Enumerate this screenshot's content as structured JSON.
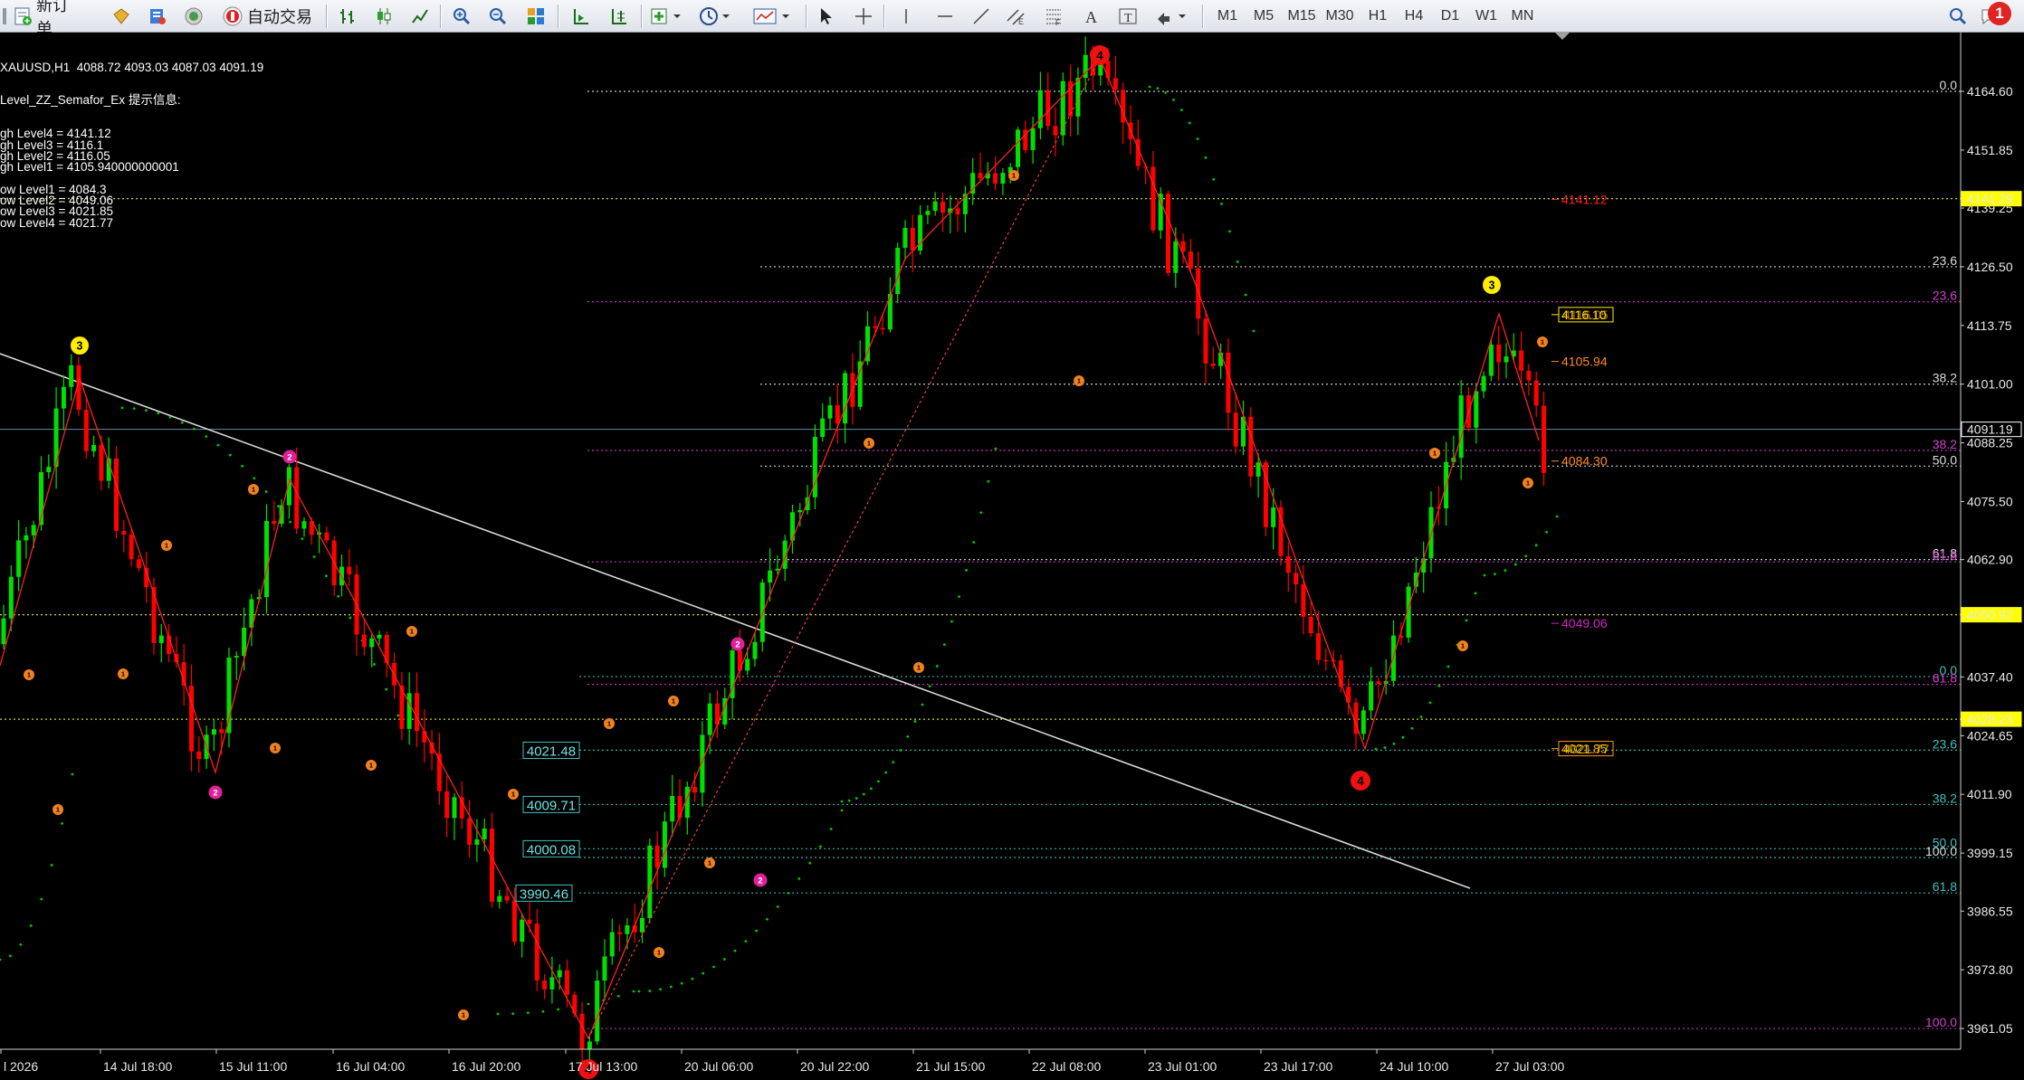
{
  "toolbar": {
    "new_order": "新订单",
    "auto_trading": "自动交易",
    "timeframes": [
      "M1",
      "M5",
      "M15",
      "M30",
      "H1",
      "H4",
      "D1",
      "W1",
      "MN"
    ],
    "notification_count": "1",
    "icons": [
      "new-order-icon",
      "strategy-tester-icon",
      "market-watch-icon",
      "signals-icon",
      "auto-trading-icon",
      "bar-chart-icon",
      "candlestick-icon",
      "line-chart-icon",
      "zoom-in-icon",
      "zoom-out-icon",
      "tile-windows-icon",
      "auto-scroll-icon",
      "chart-shift-icon",
      "indicators-icon",
      "periods-icon",
      "templates-icon",
      "cursor-icon",
      "crosshair-icon",
      "vertical-line-icon",
      "horizontal-line-icon",
      "trendline-icon",
      "equidistant-channel-icon",
      "fibonacci-icon",
      "text-icon",
      "text-label-icon",
      "arrows-icon",
      "search-icon",
      "chat-icon"
    ]
  },
  "info": {
    "symbol_line": "XAUUSD,H1  4088.72 4093.03 4087.03 4091.19",
    "indicator": "Level_ZZ_Semafor_Ex 提示信息:",
    "levels": [
      "gh Level4 = 4141.12",
      "gh Level3 = 4116.1",
      "gh Level2 = 4116.05",
      "gh Level1 = 4105.940000000001",
      "",
      "ow Level1 = 4084.3",
      "ow Level2 = 4049.06",
      "ow Level3 = 4021.85",
      "ow Level4 = 4021.77"
    ]
  },
  "price_axis": {
    "ticks": [
      "4164.60",
      "4151.85",
      "4139.25",
      "4126.50",
      "4113.75",
      "4101.00",
      "4088.25",
      "4075.50",
      "4062.90",
      "4037.40",
      "4024.65",
      "4011.90",
      "3999.15",
      "3986.55",
      "3973.80",
      "3961.05"
    ],
    "highlights": [
      {
        "label": "4141.29",
        "bg": "#ffff00",
        "fg": "#000000"
      },
      {
        "label": "4091.19",
        "bg": "#000000",
        "fg": "#ffffff"
      },
      {
        "label": "4050.92",
        "bg": "#ffff00",
        "fg": "#000000"
      },
      {
        "label": "4028.23",
        "bg": "#ffff00",
        "fg": "#000000"
      }
    ]
  },
  "time_axis": [
    "l 2026",
    "14 Jul 18:00",
    "15 Jul 11:00",
    "16 Jul 04:00",
    "16 Jul 20:00",
    "17 Jul 13:00",
    "20 Jul 06:00",
    "20 Jul 22:00",
    "21 Jul 15:00",
    "22 Jul 08:00",
    "23 Jul 01:00",
    "23 Jul 17:00",
    "24 Jul 10:00",
    "27 Jul 03:00"
  ],
  "levels_right": [
    {
      "text": "4141.12",
      "color": "#ff2020"
    },
    {
      "text": "4116.10",
      "color": "#ffee00"
    },
    {
      "text": "4116.05",
      "color": "#ff9900"
    },
    {
      "text": "4105.94",
      "color": "#ff8a20"
    },
    {
      "text": "4084.30",
      "color": "#ff8a20"
    },
    {
      "text": "4049.06",
      "color": "#d028c8"
    },
    {
      "text": "4021.85",
      "color": "#ff9900"
    },
    {
      "text": "4021.77",
      "color": "#ffee00"
    }
  ],
  "fib_boxes": [
    "4021.48",
    "4009.71",
    "4000.08",
    "3990.46"
  ],
  "fib_labels": {
    "white_top": "0.0",
    "white_236": "23.6",
    "white_382": "38.2",
    "white_50": "50.0",
    "white_618": "61.8",
    "mag_236": "23.6",
    "mag_382": "38.2",
    "mag_618": "61.8",
    "mag_100": "100.0",
    "cyan_0": "0.0",
    "cyan_236": "23.6",
    "cyan_382": "38.2",
    "cyan_50": "50.0",
    "cyan_618": "61.8",
    "cyan_100": "100.0"
  },
  "semafor": {
    "n4": "4",
    "n3": "3",
    "n2": "2",
    "n1": "1"
  },
  "colors": {
    "bull": "#00e000",
    "bear": "#ff0000",
    "zigzag": "#ff2020",
    "psar": "#00c800",
    "trend": "#d8d8d8",
    "grid_white": "#c8c8c8",
    "grid_mag": "#c030c0",
    "grid_cyan": "#30b0b0",
    "grid_yellow": "#d8d820"
  }
}
